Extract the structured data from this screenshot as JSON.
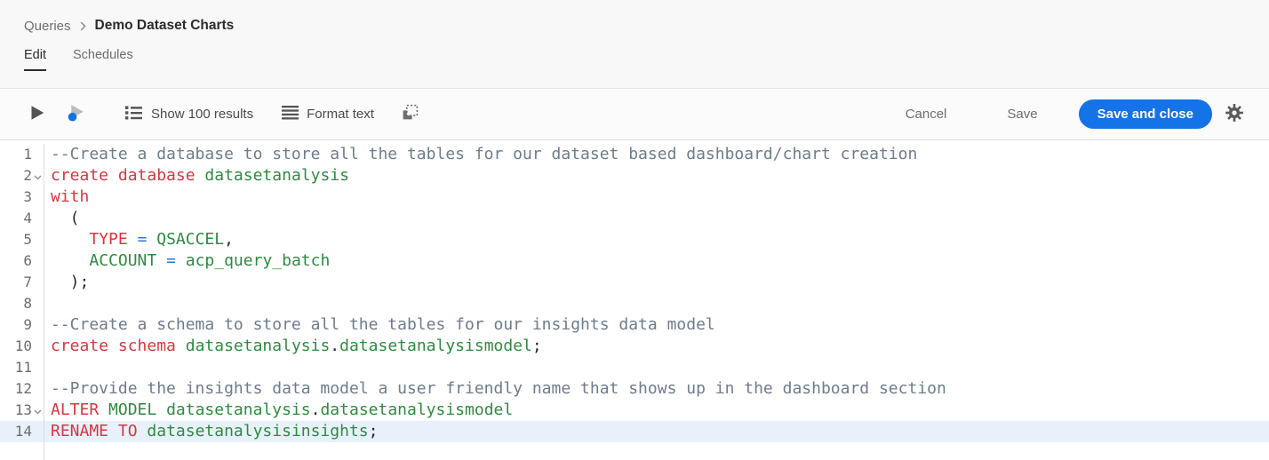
{
  "breadcrumb": {
    "parent": "Queries",
    "current": "Demo Dataset Charts"
  },
  "tabs": [
    {
      "label": "Edit",
      "active": true
    },
    {
      "label": "Schedules",
      "active": false
    }
  ],
  "toolbar": {
    "show_results_label": "Show 100 results",
    "format_text_label": "Format text",
    "cancel_label": "Cancel",
    "save_label": "Save",
    "save_and_close_label": "Save and close"
  },
  "icons": [
    "run-icon",
    "run-selected-icon",
    "show-results-list-icon",
    "format-text-icon",
    "select-container-icon",
    "settings-gear-icon",
    "breadcrumb-separator-icon",
    "fold-chevron-icon"
  ],
  "colors": {
    "accent_blue": "#1473e6",
    "keyword": "#d7373f",
    "identifier": "#2e8b3f",
    "operator": "#2e77d0",
    "comment": "#6e7c8c",
    "plain": "#24292e",
    "active_line_bg": "#e8f1fb",
    "header_bg": "#f8f8f8",
    "toolbar_bg": "#fbfbfb",
    "editor_bg": "#ffffff",
    "line_number": "#6d6d6d",
    "border": "#dcdcdc"
  },
  "editor": {
    "lines": [
      {
        "num": 1,
        "fold": false,
        "active": false,
        "tokens": [
          {
            "s": "c",
            "t": "--Create a database to store all the tables for our dataset based dashboard/chart creation"
          }
        ]
      },
      {
        "num": 2,
        "fold": true,
        "active": false,
        "tokens": [
          {
            "s": "k",
            "t": "create database"
          },
          {
            "s": "p",
            "t": " "
          },
          {
            "s": "v",
            "t": "datasetanalysis"
          }
        ]
      },
      {
        "num": 3,
        "fold": false,
        "active": false,
        "tokens": [
          {
            "s": "k",
            "t": "with"
          }
        ]
      },
      {
        "num": 4,
        "fold": false,
        "active": false,
        "tokens": [
          {
            "s": "p",
            "t": "  ("
          }
        ]
      },
      {
        "num": 5,
        "fold": false,
        "active": false,
        "tokens": [
          {
            "s": "p",
            "t": "    "
          },
          {
            "s": "k",
            "t": "TYPE"
          },
          {
            "s": "p",
            "t": " "
          },
          {
            "s": "o",
            "t": "="
          },
          {
            "s": "p",
            "t": " "
          },
          {
            "s": "v",
            "t": "QSACCEL"
          },
          {
            "s": "p",
            "t": ","
          }
        ]
      },
      {
        "num": 6,
        "fold": false,
        "active": false,
        "tokens": [
          {
            "s": "p",
            "t": "    "
          },
          {
            "s": "v",
            "t": "ACCOUNT"
          },
          {
            "s": "p",
            "t": " "
          },
          {
            "s": "o",
            "t": "="
          },
          {
            "s": "p",
            "t": " "
          },
          {
            "s": "v",
            "t": "acp_query_batch"
          }
        ]
      },
      {
        "num": 7,
        "fold": false,
        "active": false,
        "tokens": [
          {
            "s": "p",
            "t": "  );"
          }
        ]
      },
      {
        "num": 8,
        "fold": false,
        "active": false,
        "tokens": []
      },
      {
        "num": 9,
        "fold": false,
        "active": false,
        "tokens": [
          {
            "s": "c",
            "t": "--Create a schema to store all the tables for our insights data model"
          }
        ]
      },
      {
        "num": 10,
        "fold": false,
        "active": false,
        "tokens": [
          {
            "s": "k",
            "t": "create schema"
          },
          {
            "s": "p",
            "t": " "
          },
          {
            "s": "v",
            "t": "datasetanalysis"
          },
          {
            "s": "p",
            "t": "."
          },
          {
            "s": "v",
            "t": "datasetanalysismodel"
          },
          {
            "s": "p",
            "t": ";"
          }
        ]
      },
      {
        "num": 11,
        "fold": false,
        "active": false,
        "tokens": []
      },
      {
        "num": 12,
        "fold": false,
        "active": false,
        "tokens": [
          {
            "s": "c",
            "t": "--Provide the insights data model a user friendly name that shows up in the dashboard section"
          }
        ]
      },
      {
        "num": 13,
        "fold": true,
        "active": false,
        "tokens": [
          {
            "s": "k",
            "t": "ALTER"
          },
          {
            "s": "p",
            "t": " "
          },
          {
            "s": "v",
            "t": "MODEL"
          },
          {
            "s": "p",
            "t": " "
          },
          {
            "s": "v",
            "t": "datasetanalysis"
          },
          {
            "s": "p",
            "t": "."
          },
          {
            "s": "v",
            "t": "datasetanalysismodel"
          }
        ]
      },
      {
        "num": 14,
        "fold": false,
        "active": true,
        "tokens": [
          {
            "s": "k",
            "t": "RENAME TO"
          },
          {
            "s": "p",
            "t": " "
          },
          {
            "s": "v",
            "t": "datasetanalysisinsights"
          },
          {
            "s": "p",
            "t": ";"
          }
        ]
      }
    ]
  }
}
